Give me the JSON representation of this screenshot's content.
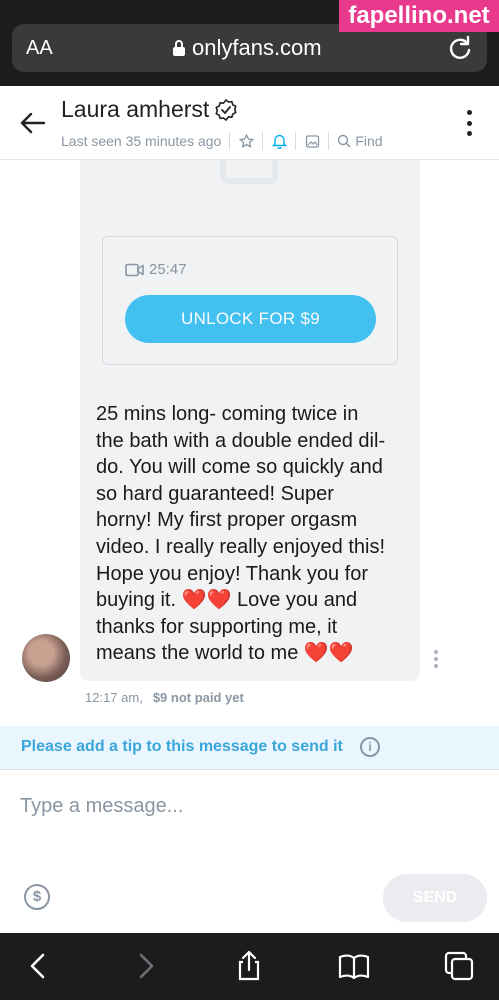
{
  "browser": {
    "text_size_label": "AA",
    "url": "onlyfans.com",
    "watermark": "fapellino.net"
  },
  "header": {
    "name": "Laura amherst",
    "status": "Last seen 35 minutes ago",
    "find_label": "Find"
  },
  "message": {
    "duration": "25:47",
    "unlock_label": "UNLOCK FOR $9",
    "text": "25 mins long- coming twice in\nthe bath with a double ended dil-\ndo. You will come so quickly and\nso hard guaranteed! Super\nhorny! My first proper orgasm\nvideo. I really really enjoyed this!\nHope you enjoy! Thank you for\nbuying it. ❤️❤️ Love you and\nthanks for supporting me, it\nmeans the world to me ❤️❤️",
    "time": "12:17 am,",
    "price_status": "$9 not paid yet"
  },
  "tip_notice": "Please add a tip to this message to send it",
  "composer": {
    "placeholder": "Type a message...",
    "send_label": "SEND",
    "tip_symbol": "$"
  },
  "colors": {
    "accent": "#00aeef",
    "tip_text": "#3ba6da",
    "muted": "#8a96a3"
  }
}
